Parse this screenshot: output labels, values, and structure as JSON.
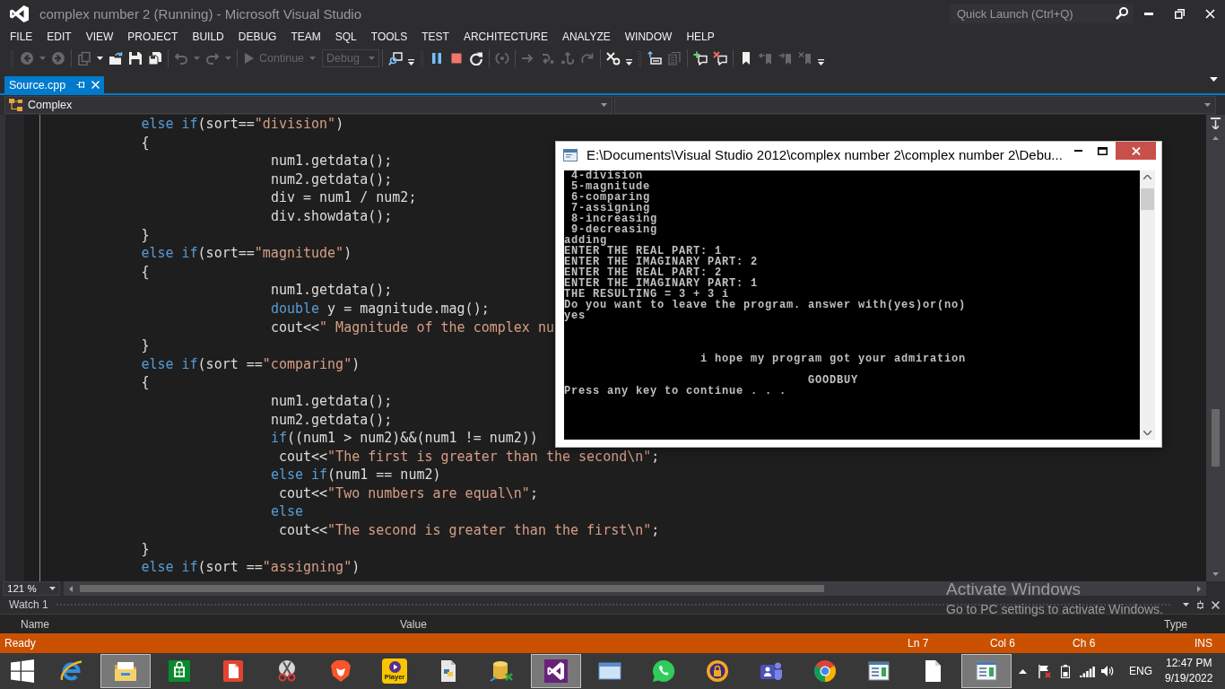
{
  "window": {
    "title": "complex number 2 (Running) - Microsoft Visual Studio",
    "quick_launch": {
      "placeholder": "Quick Launch (Ctrl+Q)"
    }
  },
  "menu": [
    "FILE",
    "EDIT",
    "VIEW",
    "PROJECT",
    "BUILD",
    "DEBUG",
    "TEAM",
    "SQL",
    "TOOLS",
    "TEST",
    "ARCHITECTURE",
    "ANALYZE",
    "WINDOW",
    "HELP"
  ],
  "toolbar": {
    "groups": [
      {
        "grip": true,
        "items": [
          {
            "kind": "back",
            "disabled": true
          },
          {
            "kind": "caret",
            "disabled": true
          },
          {
            "kind": "forward",
            "disabled": true
          }
        ]
      },
      {
        "grip": false,
        "items": [
          {
            "kind": "newproject",
            "disabled": true
          },
          {
            "kind": "caret",
            "disabled": false
          },
          {
            "kind": "open",
            "disabled": false
          },
          {
            "kind": "save",
            "disabled": false
          },
          {
            "kind": "saveall",
            "disabled": false
          }
        ]
      },
      {
        "grip": false,
        "items": [
          {
            "kind": "undo",
            "disabled": true
          },
          {
            "kind": "caret",
            "disabled": true
          },
          {
            "kind": "redo",
            "disabled": true
          },
          {
            "kind": "caret",
            "disabled": true
          }
        ]
      },
      {
        "grip": false,
        "items": [
          {
            "kind": "run",
            "label": "Continue",
            "disabled": true
          },
          {
            "kind": "caret",
            "disabled": true
          },
          {
            "kind": "combo",
            "value": "Debug",
            "disabled": true
          }
        ]
      },
      {
        "grip": false,
        "items": [
          {
            "kind": "find",
            "disabled": false
          },
          {
            "kind": "overflow",
            "disabled": false
          }
        ]
      },
      {
        "grip": true,
        "items": [
          {
            "kind": "pause",
            "disabled": false
          },
          {
            "kind": "stop",
            "disabled": false
          },
          {
            "kind": "restart",
            "disabled": false
          }
        ]
      },
      {
        "grip": false,
        "items": [
          {
            "kind": "nextstatement",
            "disabled": true
          }
        ]
      },
      {
        "grip": false,
        "items": [
          {
            "kind": "stepnext",
            "disabled": true
          },
          {
            "kind": "stepinto",
            "disabled": true
          },
          {
            "kind": "stepout",
            "disabled": true
          },
          {
            "kind": "stepover",
            "disabled": true
          }
        ]
      },
      {
        "grip": false,
        "items": [
          {
            "kind": "hex",
            "disabled": false
          },
          {
            "kind": "overflow",
            "disabled": false
          }
        ]
      },
      {
        "grip": true,
        "items": [
          {
            "kind": "windowarrow",
            "disabled": false
          },
          {
            "kind": "list",
            "disabled": true
          }
        ]
      },
      {
        "grip": false,
        "items": [
          {
            "kind": "addcomment",
            "disabled": false
          },
          {
            "kind": "removecomment",
            "disabled": false
          }
        ]
      },
      {
        "grip": false,
        "items": [
          {
            "kind": "bookmark",
            "disabled": false
          },
          {
            "kind": "bookmarkprev",
            "disabled": true
          },
          {
            "kind": "bookmarknext",
            "disabled": true
          },
          {
            "kind": "bookmarkclear",
            "disabled": true
          },
          {
            "kind": "overflow",
            "disabled": false
          }
        ]
      }
    ]
  },
  "tabs": [
    {
      "label": "Source.cpp",
      "selected": true
    }
  ],
  "navigation": {
    "scope": "Complex"
  },
  "editor": {
    "lines": [
      {
        "tokens": [
          {
            "kind": "keyword",
            "text": "\t\t\telse if"
          },
          {
            "kind": "plain",
            "text": "(sort=="
          },
          {
            "kind": "string",
            "text": "\"division\""
          },
          {
            "kind": "plain",
            "text": ")"
          }
        ]
      },
      {
        "tokens": [
          {
            "kind": "plain",
            "text": "\t\t\t{"
          }
        ]
      },
      {
        "tokens": [
          {
            "kind": "plain",
            "text": "\t\t\t\t\t\t\tnum1.getdata();"
          }
        ]
      },
      {
        "tokens": [
          {
            "kind": "plain",
            "text": "\t\t\t\t\t\t\tnum2.getdata();"
          }
        ]
      },
      {
        "tokens": [
          {
            "kind": "plain",
            "text": "\t\t\t\t\t\t\tdiv = num1 / num2;"
          }
        ]
      },
      {
        "tokens": [
          {
            "kind": "plain",
            "text": "\t\t\t\t\t\t\tdiv.showdata();"
          }
        ]
      },
      {
        "tokens": [
          {
            "kind": "plain",
            "text": "\t\t\t}"
          }
        ]
      },
      {
        "tokens": [
          {
            "kind": "keyword",
            "text": "\t\t\telse if"
          },
          {
            "kind": "plain",
            "text": "(sort=="
          },
          {
            "kind": "string",
            "text": "\"magnitude\""
          },
          {
            "kind": "plain",
            "text": ")"
          }
        ]
      },
      {
        "tokens": [
          {
            "kind": "plain",
            "text": "\t\t\t{"
          }
        ]
      },
      {
        "tokens": [
          {
            "kind": "plain",
            "text": "\t\t\t\t\t\t\tnum1.getdata();"
          }
        ]
      },
      {
        "tokens": [
          {
            "kind": "keyword",
            "text": "\t\t\t\t\t\t\tdouble"
          },
          {
            "kind": "plain",
            "text": " y = magnitude.mag();"
          }
        ]
      },
      {
        "tokens": [
          {
            "kind": "plain",
            "text": "\t\t\t\t\t\t\tcout<<"
          },
          {
            "kind": "string",
            "text": "\" Magnitude of the complex nu"
          }
        ]
      },
      {
        "tokens": [
          {
            "kind": "plain",
            "text": "\t\t\t}"
          }
        ]
      },
      {
        "tokens": [
          {
            "kind": "keyword",
            "text": "\t\t\telse if"
          },
          {
            "kind": "plain",
            "text": "(sort =="
          },
          {
            "kind": "string",
            "text": "\"comparing\""
          },
          {
            "kind": "plain",
            "text": ")"
          }
        ]
      },
      {
        "tokens": [
          {
            "kind": "plain",
            "text": "\t\t\t{"
          }
        ]
      },
      {
        "tokens": [
          {
            "kind": "plain",
            "text": "\t\t\t\t\t\t\tnum1.getdata();"
          }
        ]
      },
      {
        "tokens": [
          {
            "kind": "plain",
            "text": "\t\t\t\t\t\t\tnum2.getdata();"
          }
        ]
      },
      {
        "tokens": [
          {
            "kind": "keyword",
            "text": "\t\t\t\t\t\t\tif"
          },
          {
            "kind": "plain",
            "text": "((num1 > num2)&&(num1 != num2))"
          }
        ]
      },
      {
        "tokens": [
          {
            "kind": "plain",
            "text": "\t\t\t\t\t\t\t cout<<"
          },
          {
            "kind": "string",
            "text": "\"The first is greater than the second\\n\""
          },
          {
            "kind": "plain",
            "text": ";"
          }
        ]
      },
      {
        "tokens": [
          {
            "kind": "keyword",
            "text": "\t\t\t\t\t\t\telse if"
          },
          {
            "kind": "plain",
            "text": "(num1 == num2)"
          }
        ]
      },
      {
        "tokens": [
          {
            "kind": "plain",
            "text": "\t\t\t\t\t\t\t cout<<"
          },
          {
            "kind": "string",
            "text": "\"Two numbers are equal\\n\""
          },
          {
            "kind": "plain",
            "text": ";"
          }
        ]
      },
      {
        "tokens": [
          {
            "kind": "keyword",
            "text": "\t\t\t\t\t\t\telse"
          }
        ]
      },
      {
        "tokens": [
          {
            "kind": "plain",
            "text": "\t\t\t\t\t\t\t cout<<"
          },
          {
            "kind": "string",
            "text": "\"The second is greater than the first\\n\""
          },
          {
            "kind": "plain",
            "text": ";"
          }
        ]
      },
      {
        "tokens": [
          {
            "kind": "plain",
            "text": "\t\t\t}"
          }
        ]
      },
      {
        "tokens": [
          {
            "kind": "keyword",
            "text": "\t\t\telse if"
          },
          {
            "kind": "plain",
            "text": "(sort =="
          },
          {
            "kind": "string",
            "text": "\"assigning\""
          },
          {
            "kind": "plain",
            "text": ")"
          }
        ]
      }
    ],
    "zoom": "121 %"
  },
  "console_window": {
    "title": "E:\\Documents\\Visual Studio 2012\\complex number 2\\complex number 2\\Debu...",
    "lines": [
      {
        "kind": "text",
        "text": " 4-division"
      },
      {
        "kind": "text",
        "text": " 5-magnitude"
      },
      {
        "kind": "text",
        "text": " 6-comparing"
      },
      {
        "kind": "text",
        "text": " 7-assigning"
      },
      {
        "kind": "text",
        "text": " 8-increasing"
      },
      {
        "kind": "text",
        "text": " 9-decreasing"
      },
      {
        "kind": "text",
        "text": "adding"
      },
      {
        "kind": "text",
        "text": "ENTER THE REAL PART: 1"
      },
      {
        "kind": "text",
        "text": "ENTER THE IMAGINARY PART: 2"
      },
      {
        "kind": "text",
        "text": "ENTER THE REAL PART: 2"
      },
      {
        "kind": "text",
        "text": "ENTER THE IMAGINARY PART: 1"
      },
      {
        "kind": "text",
        "text": "THE RESULTING = 3 + 3 i"
      },
      {
        "kind": "text",
        "text": "Do you want to leave the program. answer with(yes)or(no)"
      },
      {
        "kind": "text",
        "text": "yes"
      },
      {
        "kind": "blank"
      },
      {
        "kind": "blank"
      },
      {
        "kind": "blank"
      },
      {
        "kind": "text",
        "text": "                   i hope my program got your admiration"
      },
      {
        "kind": "blank"
      },
      {
        "kind": "text",
        "text": "                                  GOODBUY"
      },
      {
        "kind": "text",
        "text": "Press any key to continue . . ."
      }
    ]
  },
  "watch_panel": {
    "title": "Watch 1",
    "columns": [
      "Name",
      "Value",
      "Type"
    ]
  },
  "activation_notice": {
    "heading": "Activate Windows",
    "message": "Go to PC settings to activate Windows."
  },
  "status_bar": {
    "message": "Ready",
    "line": "Ln 7",
    "column": "Col 6",
    "char": "Ch 6",
    "mode": "INS"
  },
  "taskbar": {
    "apps": [
      {
        "kind": "ie",
        "active": false
      },
      {
        "kind": "explorer",
        "active": true
      },
      {
        "kind": "store",
        "active": false
      },
      {
        "kind": "office",
        "active": false
      },
      {
        "kind": "snipping",
        "active": false
      },
      {
        "kind": "brave",
        "active": false
      },
      {
        "kind": "player",
        "label": "Player",
        "active": false
      },
      {
        "kind": "python",
        "active": false
      },
      {
        "kind": "database",
        "active": false
      },
      {
        "kind": "studio",
        "active": true
      },
      {
        "kind": "window",
        "active": false
      },
      {
        "kind": "whatsapp",
        "active": false
      },
      {
        "kind": "lock",
        "active": false
      },
      {
        "kind": "teams",
        "active": false
      },
      {
        "kind": "chrome",
        "active": false
      },
      {
        "kind": "monitor",
        "active": false
      },
      {
        "kind": "page",
        "active": false
      },
      {
        "kind": "viewer",
        "active": true
      }
    ],
    "tray": {
      "language": "ENG",
      "time": "12:47 PM",
      "date": "9/19/2022"
    }
  }
}
